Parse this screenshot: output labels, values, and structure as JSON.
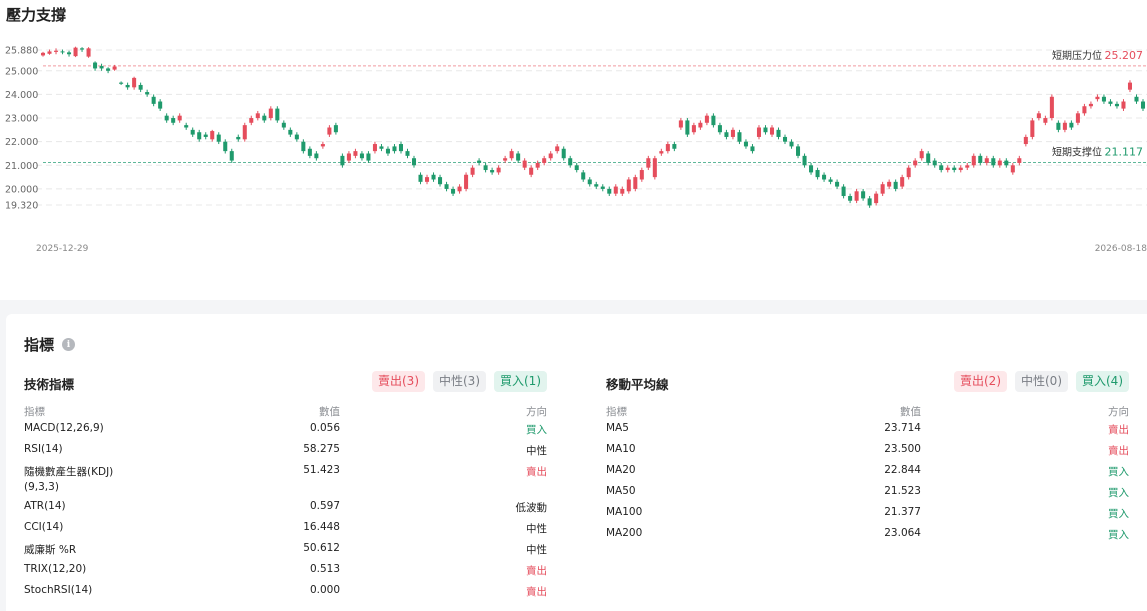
{
  "section_title": "壓力支撐",
  "colors": {
    "up": "#e54d5c",
    "down": "#1f9a6c",
    "resistance": "#f19aa0",
    "support": "#5fb89a"
  },
  "chart_data": {
    "type": "candlestick",
    "y_ticks": [
      "25.880",
      "25.000",
      "24.000",
      "23.000",
      "22.000",
      "21.000",
      "20.000",
      "19.320"
    ],
    "ylim": [
      19.32,
      25.88
    ],
    "x_labels": [
      "2025-12-29",
      "2026-08-18"
    ],
    "resistance": {
      "label": "短期压力位",
      "value": 25.207,
      "value_text": "25.207"
    },
    "support": {
      "label": "短期支撑位",
      "value": 21.117,
      "value_text": "21.117"
    },
    "candles": [
      [
        25.65,
        25.76,
        25.6,
        25.8
      ],
      [
        25.72,
        25.82,
        25.68,
        25.9
      ],
      [
        25.8,
        25.85,
        25.7,
        25.95
      ],
      [
        25.82,
        25.78,
        25.7,
        25.9
      ],
      [
        25.78,
        25.7,
        25.6,
        25.85
      ],
      [
        25.62,
        25.98,
        25.58,
        26.02
      ],
      [
        25.95,
        25.9,
        25.8,
        26.0
      ],
      [
        25.6,
        25.95,
        25.55,
        26.0
      ],
      [
        25.35,
        25.1,
        25.0,
        25.4
      ],
      [
        25.2,
        25.1,
        25.0,
        25.3
      ],
      [
        25.1,
        25.0,
        24.9,
        25.15
      ],
      [
        25.05,
        25.18,
        25.0,
        25.25
      ],
      [
        24.5,
        24.45,
        24.4,
        24.55
      ],
      [
        24.4,
        24.3,
        24.2,
        24.5
      ],
      [
        24.3,
        24.7,
        24.2,
        24.75
      ],
      [
        24.4,
        24.2,
        24.1,
        24.5
      ],
      [
        24.1,
        24.0,
        23.9,
        24.2
      ],
      [
        23.9,
        23.6,
        23.5,
        24.0
      ],
      [
        23.7,
        23.4,
        23.3,
        23.8
      ],
      [
        23.1,
        22.9,
        22.8,
        23.2
      ],
      [
        23.0,
        22.8,
        22.7,
        23.1
      ],
      [
        22.9,
        23.1,
        22.8,
        23.2
      ],
      [
        22.7,
        22.6,
        22.5,
        22.8
      ],
      [
        22.5,
        22.3,
        22.2,
        22.6
      ],
      [
        22.4,
        22.1,
        22.0,
        22.5
      ],
      [
        22.3,
        22.2,
        22.1,
        22.4
      ],
      [
        22.1,
        22.45,
        22.0,
        22.5
      ],
      [
        22.3,
        22.0,
        21.9,
        22.4
      ],
      [
        22.0,
        21.6,
        21.5,
        22.1
      ],
      [
        21.6,
        21.2,
        21.1,
        21.7
      ],
      [
        22.2,
        22.1,
        22.0,
        22.3
      ],
      [
        22.1,
        22.7,
        22.0,
        22.8
      ],
      [
        22.8,
        23.0,
        22.7,
        23.1
      ],
      [
        23.0,
        23.2,
        22.9,
        23.3
      ],
      [
        23.1,
        22.9,
        22.8,
        23.2
      ],
      [
        23.0,
        23.4,
        22.9,
        23.5
      ],
      [
        23.4,
        22.9,
        22.8,
        23.5
      ],
      [
        22.8,
        22.6,
        22.5,
        22.9
      ],
      [
        22.5,
        22.3,
        22.2,
        22.6
      ],
      [
        22.3,
        22.1,
        22.0,
        22.4
      ],
      [
        22.0,
        21.6,
        21.5,
        22.1
      ],
      [
        21.7,
        21.4,
        21.3,
        21.8
      ],
      [
        21.5,
        21.3,
        21.2,
        21.6
      ],
      [
        21.8,
        21.9,
        21.7,
        22.0
      ],
      [
        22.3,
        22.6,
        22.2,
        22.7
      ],
      [
        22.7,
        22.4,
        22.3,
        22.8
      ],
      [
        21.4,
        21.0,
        20.9,
        21.5
      ],
      [
        21.2,
        21.5,
        21.1,
        21.6
      ],
      [
        21.4,
        21.6,
        21.3,
        21.7
      ],
      [
        21.5,
        21.3,
        21.2,
        21.6
      ],
      [
        21.5,
        21.2,
        21.1,
        21.6
      ],
      [
        21.6,
        21.9,
        21.5,
        22.0
      ],
      [
        21.8,
        21.7,
        21.6,
        21.9
      ],
      [
        21.7,
        21.5,
        21.4,
        21.8
      ],
      [
        21.8,
        21.6,
        21.5,
        21.9
      ],
      [
        21.9,
        21.6,
        21.5,
        22.0
      ],
      [
        21.6,
        21.4,
        21.3,
        21.7
      ],
      [
        21.3,
        21.0,
        20.9,
        21.4
      ],
      [
        20.6,
        20.3,
        20.2,
        20.7
      ],
      [
        20.3,
        20.5,
        20.2,
        20.6
      ],
      [
        20.6,
        20.4,
        20.3,
        20.7
      ],
      [
        20.5,
        20.2,
        20.1,
        20.6
      ],
      [
        20.2,
        20.0,
        19.9,
        20.3
      ],
      [
        20.0,
        19.8,
        19.7,
        20.1
      ],
      [
        19.9,
        20.1,
        19.8,
        20.2
      ],
      [
        20.0,
        20.6,
        19.9,
        20.7
      ],
      [
        20.6,
        20.9,
        20.5,
        21.0
      ],
      [
        21.2,
        21.1,
        21.0,
        21.3
      ],
      [
        21.0,
        20.8,
        20.7,
        21.1
      ],
      [
        20.8,
        20.7,
        20.6,
        20.9
      ],
      [
        20.7,
        20.9,
        20.6,
        21.0
      ],
      [
        21.2,
        21.3,
        21.1,
        21.4
      ],
      [
        21.3,
        21.6,
        21.2,
        21.7
      ],
      [
        21.5,
        21.2,
        21.1,
        21.6
      ],
      [
        20.9,
        21.2,
        20.8,
        21.3
      ],
      [
        20.6,
        20.9,
        20.5,
        21.0
      ],
      [
        20.9,
        21.1,
        20.8,
        21.2
      ],
      [
        21.1,
        21.3,
        21.0,
        21.4
      ],
      [
        21.3,
        21.5,
        21.2,
        21.6
      ],
      [
        21.6,
        21.8,
        21.5,
        21.9
      ],
      [
        21.7,
        21.3,
        21.2,
        21.8
      ],
      [
        21.3,
        21.0,
        20.9,
        21.4
      ],
      [
        21.0,
        20.8,
        20.7,
        21.1
      ],
      [
        20.7,
        20.4,
        20.3,
        20.8
      ],
      [
        20.4,
        20.2,
        20.1,
        20.5
      ],
      [
        20.2,
        20.1,
        20.0,
        20.3
      ],
      [
        20.1,
        20.0,
        19.9,
        20.2
      ],
      [
        20.0,
        19.8,
        19.7,
        20.1
      ],
      [
        19.8,
        20.1,
        19.7,
        20.2
      ],
      [
        19.8,
        20.0,
        19.7,
        20.1
      ],
      [
        19.9,
        20.4,
        19.8,
        20.5
      ],
      [
        20.0,
        20.5,
        19.9,
        20.6
      ],
      [
        20.4,
        20.8,
        20.3,
        20.9
      ],
      [
        20.9,
        21.3,
        20.8,
        21.4
      ],
      [
        20.5,
        21.3,
        20.4,
        21.4
      ],
      [
        21.5,
        21.6,
        21.4,
        21.7
      ],
      [
        21.6,
        21.9,
        21.5,
        22.0
      ],
      [
        21.9,
        21.7,
        21.6,
        22.0
      ],
      [
        22.6,
        22.9,
        22.5,
        23.0
      ],
      [
        22.9,
        22.3,
        22.2,
        23.0
      ],
      [
        22.4,
        22.7,
        22.3,
        22.8
      ],
      [
        22.6,
        22.8,
        22.5,
        22.9
      ],
      [
        22.8,
        23.1,
        22.7,
        23.2
      ],
      [
        23.1,
        22.7,
        22.6,
        23.2
      ],
      [
        22.7,
        22.4,
        22.3,
        22.8
      ],
      [
        22.4,
        22.2,
        22.1,
        22.5
      ],
      [
        22.2,
        22.5,
        22.1,
        22.6
      ],
      [
        22.4,
        22.0,
        21.9,
        22.5
      ],
      [
        22.0,
        21.8,
        21.7,
        22.1
      ],
      [
        21.8,
        21.6,
        21.5,
        21.9
      ],
      [
        22.2,
        22.6,
        22.1,
        22.7
      ],
      [
        22.6,
        22.4,
        22.3,
        22.7
      ],
      [
        22.3,
        22.6,
        22.2,
        22.7
      ],
      [
        22.5,
        22.2,
        22.1,
        22.6
      ],
      [
        22.2,
        22.0,
        21.9,
        22.3
      ],
      [
        22.0,
        21.8,
        21.7,
        22.1
      ],
      [
        21.8,
        21.4,
        21.3,
        21.9
      ],
      [
        21.4,
        21.0,
        20.9,
        21.5
      ],
      [
        21.0,
        20.7,
        20.6,
        21.1
      ],
      [
        20.8,
        20.5,
        20.4,
        20.9
      ],
      [
        20.6,
        20.4,
        20.3,
        20.7
      ],
      [
        20.4,
        20.3,
        20.2,
        20.5
      ],
      [
        20.3,
        20.1,
        20.0,
        20.4
      ],
      [
        20.1,
        19.7,
        19.6,
        20.2
      ],
      [
        19.7,
        19.5,
        19.4,
        19.8
      ],
      [
        19.5,
        19.9,
        19.4,
        20.0
      ],
      [
        19.9,
        19.6,
        19.5,
        20.0
      ],
      [
        19.6,
        19.3,
        19.2,
        19.7
      ],
      [
        19.4,
        19.8,
        19.3,
        19.9
      ],
      [
        19.8,
        20.2,
        19.7,
        20.3
      ],
      [
        20.1,
        20.3,
        20.0,
        20.4
      ],
      [
        20.3,
        20.0,
        19.9,
        20.4
      ],
      [
        20.1,
        20.5,
        20.0,
        20.6
      ],
      [
        20.5,
        20.9,
        20.4,
        21.0
      ],
      [
        21.0,
        21.2,
        20.9,
        21.3
      ],
      [
        21.3,
        21.6,
        21.2,
        21.7
      ],
      [
        21.5,
        21.1,
        21.0,
        21.6
      ],
      [
        21.2,
        21.0,
        20.9,
        21.3
      ],
      [
        21.0,
        20.8,
        20.7,
        21.1
      ],
      [
        20.8,
        20.9,
        20.7,
        21.0
      ],
      [
        20.9,
        20.8,
        20.7,
        21.0
      ],
      [
        20.8,
        20.9,
        20.7,
        21.0
      ],
      [
        20.9,
        21.0,
        20.8,
        21.1
      ],
      [
        21.0,
        21.4,
        20.9,
        21.5
      ],
      [
        21.4,
        21.1,
        21.0,
        21.5
      ],
      [
        21.1,
        21.3,
        21.0,
        21.4
      ],
      [
        21.3,
        21.0,
        20.9,
        21.4
      ],
      [
        21.0,
        21.2,
        20.9,
        21.3
      ],
      [
        21.2,
        21.0,
        20.9,
        21.3
      ],
      [
        20.7,
        21.0,
        20.6,
        21.1
      ],
      [
        21.1,
        21.3,
        21.0,
        21.4
      ],
      [
        21.9,
        22.2,
        21.8,
        22.3
      ],
      [
        22.2,
        22.9,
        22.1,
        23.0
      ],
      [
        23.0,
        23.2,
        22.9,
        23.3
      ],
      [
        22.8,
        23.0,
        22.7,
        23.1
      ],
      [
        23.0,
        23.9,
        22.9,
        24.0
      ],
      [
        22.8,
        22.5,
        22.4,
        22.9
      ],
      [
        22.5,
        22.8,
        22.4,
        22.9
      ],
      [
        22.8,
        22.6,
        22.5,
        22.9
      ],
      [
        22.8,
        23.2,
        22.7,
        23.3
      ],
      [
        23.2,
        23.5,
        23.1,
        23.6
      ],
      [
        23.5,
        23.6,
        23.4,
        23.7
      ],
      [
        23.8,
        23.9,
        23.7,
        24.0
      ],
      [
        23.9,
        23.7,
        23.6,
        24.0
      ],
      [
        23.7,
        23.6,
        23.5,
        23.8
      ],
      [
        23.6,
        23.5,
        23.4,
        23.7
      ],
      [
        23.4,
        23.7,
        23.3,
        23.8
      ],
      [
        24.2,
        24.5,
        24.1,
        24.6
      ],
      [
        23.9,
        23.7,
        23.6,
        24.0
      ],
      [
        23.7,
        23.4,
        23.3,
        23.8
      ]
    ]
  },
  "indicators": {
    "title": "指標",
    "info_glyph": "i",
    "technical": {
      "title": "技術指標",
      "sell": "賣出(3)",
      "neutral": "中性(3)",
      "buy": "買入(1)",
      "headers": [
        "指標",
        "數值",
        "方向"
      ],
      "rows": [
        {
          "name": "MACD(12,26,9)",
          "value": "0.056",
          "direction": "買入",
          "dir_class": "buy"
        },
        {
          "name": "RSI(14)",
          "value": "58.275",
          "direction": "中性",
          "dir_class": "neutral"
        },
        {
          "name": "隨機數產生器(KDJ)",
          "name2": "(9,3,3)",
          "value": "51.423",
          "direction": "賣出",
          "dir_class": "sell"
        },
        {
          "name": "ATR(14)",
          "value": "0.597",
          "direction": "低波動",
          "dir_class": "neutral"
        },
        {
          "name": "CCI(14)",
          "value": "16.448",
          "direction": "中性",
          "dir_class": "neutral"
        },
        {
          "name": "威廉斯 %R",
          "value": "50.612",
          "direction": "中性",
          "dir_class": "neutral"
        },
        {
          "name": "TRIX(12,20)",
          "value": "0.513",
          "direction": "賣出",
          "dir_class": "sell"
        },
        {
          "name": "StochRSI(14)",
          "value": "0.000",
          "direction": "賣出",
          "dir_class": "sell"
        }
      ]
    },
    "moving_averages": {
      "title": "移動平均線",
      "sell": "賣出(2)",
      "neutral": "中性(0)",
      "buy": "買入(4)",
      "headers": [
        "指標",
        "數值",
        "方向"
      ],
      "rows": [
        {
          "name": "MA5",
          "value": "23.714",
          "direction": "賣出",
          "dir_class": "sell"
        },
        {
          "name": "MA10",
          "value": "23.500",
          "direction": "賣出",
          "dir_class": "sell"
        },
        {
          "name": "MA20",
          "value": "22.844",
          "direction": "買入",
          "dir_class": "buy"
        },
        {
          "name": "MA50",
          "value": "21.523",
          "direction": "買入",
          "dir_class": "buy"
        },
        {
          "name": "MA100",
          "value": "21.377",
          "direction": "買入",
          "dir_class": "buy"
        },
        {
          "name": "MA200",
          "value": "23.064",
          "direction": "買入",
          "dir_class": "buy"
        }
      ]
    }
  }
}
